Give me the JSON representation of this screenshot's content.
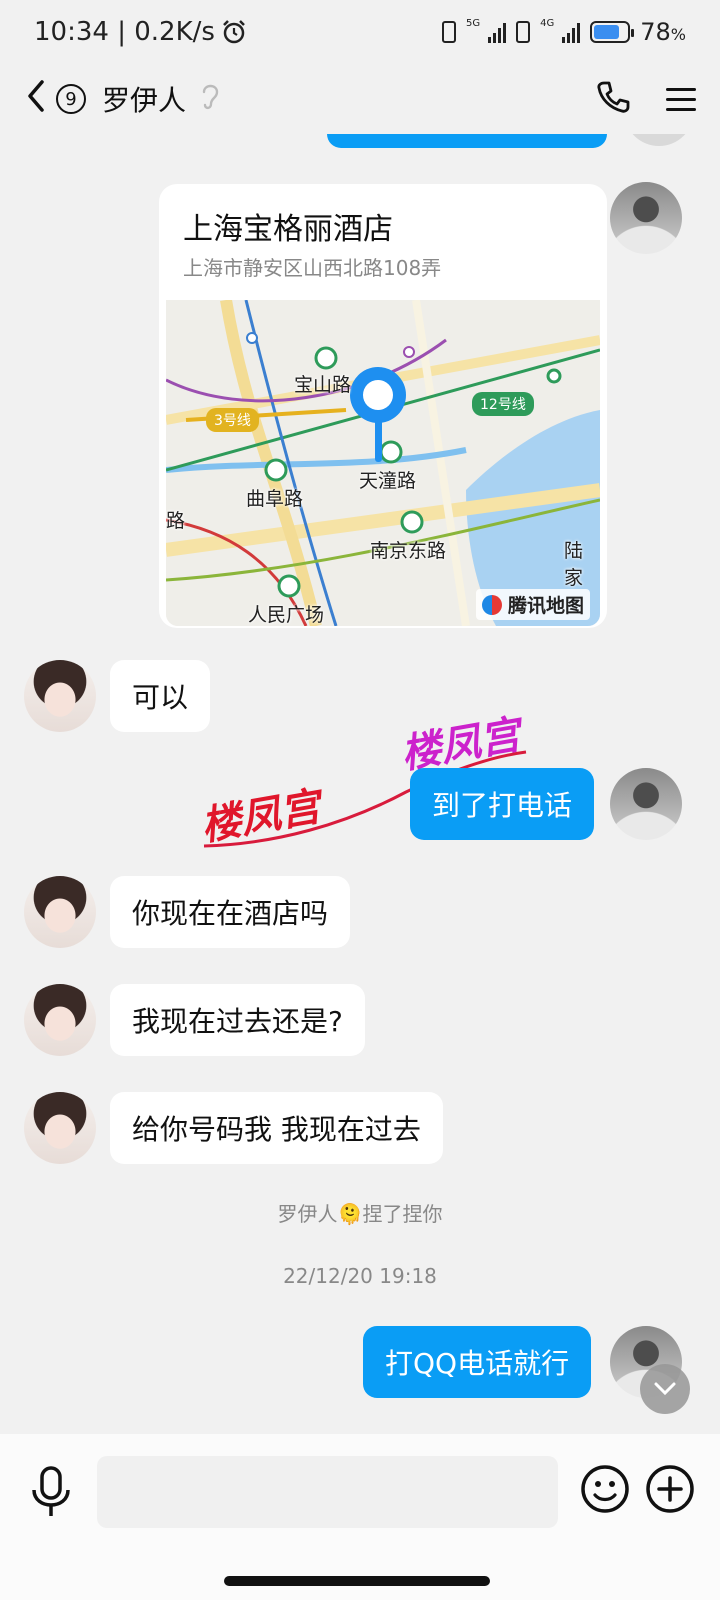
{
  "status_bar": {
    "time_speed": "10:34 | 0.2K/s",
    "alarm_icon": "alarm-icon",
    "sim1_gen": "5G",
    "sim2_gen": "4G",
    "battery": "78",
    "battery_unit": "%"
  },
  "header": {
    "back_icon": "chevron-left-icon",
    "unread_count": "9",
    "contact_name": "罗伊人",
    "ear_icon": "ear-icon",
    "call_icon": "phone-icon",
    "menu_icon": "menu-icon"
  },
  "location": {
    "title": "上海宝格丽酒店",
    "address": "上海市静安区山西北路108弄",
    "map": {
      "labels": [
        "宝山路",
        "天潼路",
        "曲阜路",
        "南京东路",
        "人民广场",
        "陆家",
        "路"
      ],
      "line_tags": [
        "3号线",
        "12号线"
      ],
      "brand": "腾讯地图"
    }
  },
  "messages": [
    {
      "from": "her",
      "text": "可以"
    },
    {
      "from": "me",
      "text": "到了打电话"
    },
    {
      "from": "her",
      "text": "你现在在酒店吗"
    },
    {
      "from": "her",
      "text": "我现在过去还是?"
    },
    {
      "from": "her",
      "text": "给你号码我 我现在过去"
    },
    {
      "from": "me",
      "text": "打QQ电话就行"
    }
  ],
  "watermark": {
    "text1": "楼凤宫",
    "text2": "楼凤宫"
  },
  "system": {
    "poke_name": "罗伊人",
    "poke_emoji": "🫠",
    "poke_text": "捏了捏你",
    "timestamp": "22/12/20 19:18"
  },
  "input": {
    "placeholder": ""
  },
  "colors": {
    "out_bubble": "#0a9df5",
    "in_bubble": "#ffffff",
    "background": "#f1f1f1",
    "watermark_magenta": "#cc22cc",
    "watermark_red": "#e0162b"
  }
}
